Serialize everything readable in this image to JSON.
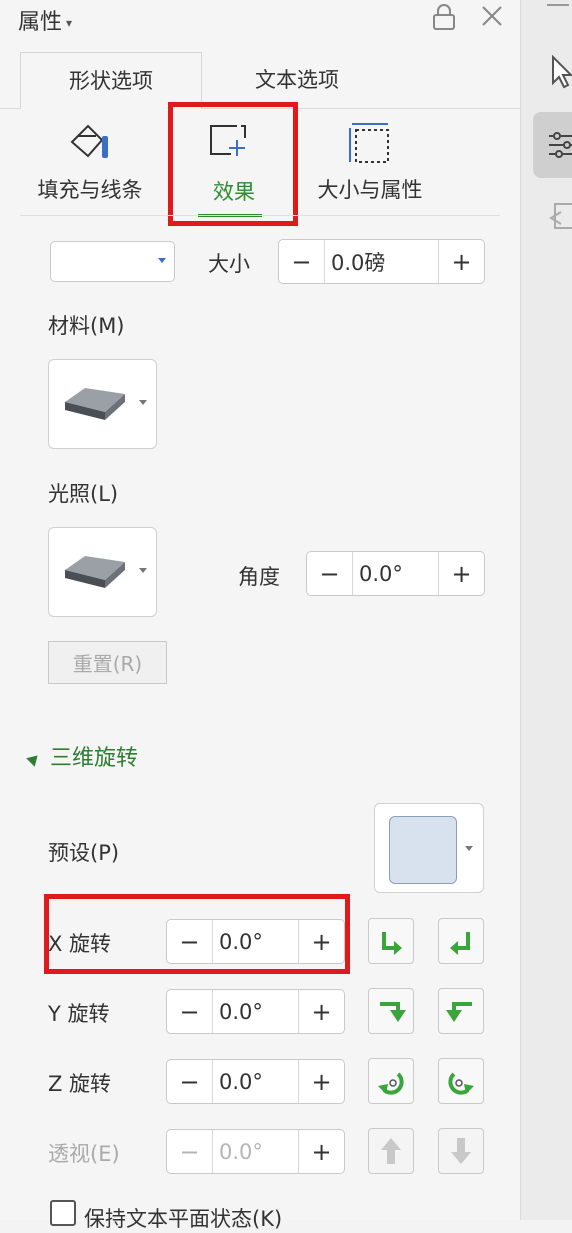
{
  "header": {
    "title": "属性"
  },
  "tabs": [
    {
      "label": "形状选项",
      "active": true
    },
    {
      "label": "文本选项",
      "active": false
    }
  ],
  "subtabs": [
    {
      "label": "填充与线条",
      "icon": "fill-line-icon"
    },
    {
      "label": "效果",
      "icon": "effects-icon",
      "active": true
    },
    {
      "label": "大小与属性",
      "icon": "size-properties-icon"
    }
  ],
  "bevel": {
    "size_label": "大小",
    "size_value": "0.0磅",
    "material_label": "材料(M)",
    "lighting_label": "光照(L)",
    "angle_label": "角度",
    "angle_value": "0.0°",
    "reset_label": "重置(R)"
  },
  "rotation": {
    "section_title": "三维旋转",
    "preset_label": "预设(P)",
    "x_label": "X 旋转",
    "x_value": "0.0°",
    "y_label": "Y 旋转",
    "y_value": "0.0°",
    "z_label": "Z 旋转",
    "z_value": "0.0°",
    "perspective_label": "透视(E)",
    "perspective_value": "0.0°",
    "keep_text_flat_label": "保持文本平面状态(K)"
  },
  "stepper": {
    "minus": "−",
    "plus": "+"
  },
  "colors": {
    "accent_green": "#2e7d32",
    "highlight_red": "#e01a1a",
    "arrow_green": "#3aa53a"
  }
}
